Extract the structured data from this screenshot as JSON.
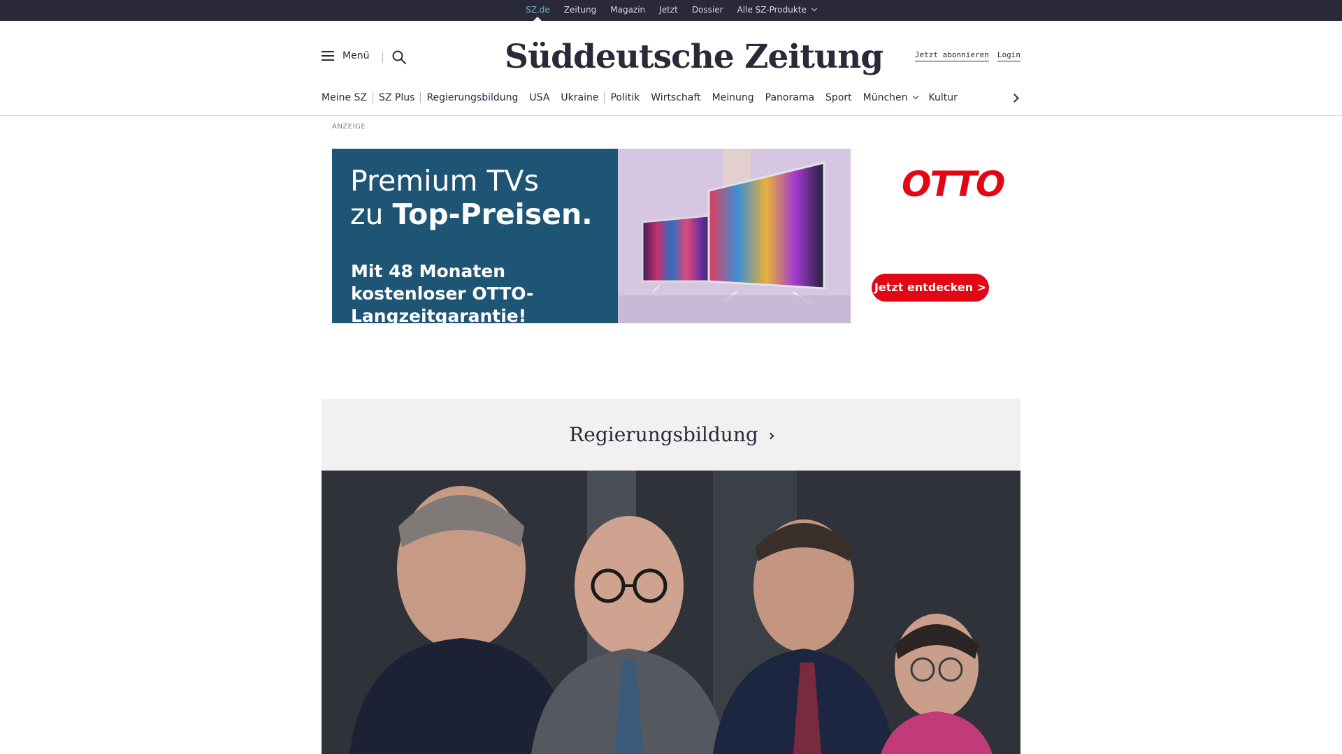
{
  "topbar": {
    "items": [
      {
        "label": "SZ.de",
        "active": true
      },
      {
        "label": "Zeitung"
      },
      {
        "label": "Magazin"
      },
      {
        "label": "Jetzt"
      },
      {
        "label": "Dossier"
      },
      {
        "label": "Alle SZ-Produkte",
        "dropdown": true
      }
    ]
  },
  "header": {
    "menu_label": "Menü",
    "logo_text": "Süddeutsche Zeitung",
    "subscribe_label": "Jetzt abonnieren",
    "login_label": "Login"
  },
  "nav": {
    "items": [
      "Meine SZ",
      "SZ Plus",
      "Regierungsbildung",
      "USA",
      "Ukraine",
      "Politik",
      "Wirtschaft",
      "Meinung",
      "Panorama",
      "Sport",
      "München",
      "Kultur"
    ]
  },
  "ad": {
    "label": "ANZEIGE",
    "headline_1": "Premium TVs",
    "headline_2_prefix": "zu ",
    "headline_2_bold": "Top-Preisen.",
    "subline": "Mit 48 Monaten kostenloser OTTO-Langzeitgarantie!",
    "brand": "OTTO",
    "cta": "Jetzt entdecken >",
    "colors": {
      "panel": "#1f5574",
      "brand": "#e30613"
    }
  },
  "section": {
    "title": "Regierungsbildung"
  },
  "colors": {
    "topbar_bg": "#29293a",
    "active_link": "#6fb1c8",
    "text": "#29293a",
    "section_bg": "#f1f1f1"
  }
}
